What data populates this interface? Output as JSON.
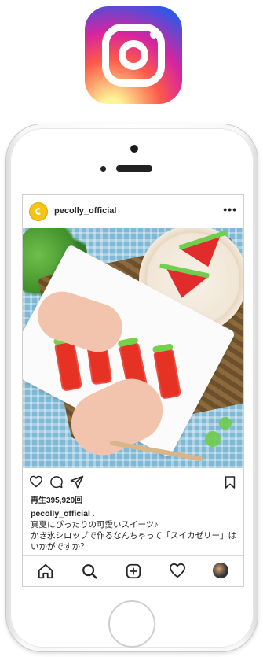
{
  "app": {
    "name": "Instagram"
  },
  "post": {
    "username": "pecolly_official",
    "more_icon": "•••",
    "views": "再生395,920回",
    "caption": {
      "username": "pecolly_official",
      "text": " .\n真夏にぴったりの可愛いスイーツ♪\nかき氷シロップで作るなんちゃって「スイカゼリー」はいかがですか？"
    }
  },
  "colors": {
    "accent_yellow": "#f6c317",
    "watermelon_red": "#e22b2b",
    "rind_green": "#6fcf4d",
    "instagram_gradient": [
      "#fdf497",
      "#fd5949",
      "#d6249f",
      "#285AEB"
    ]
  },
  "icons": {
    "logo": "instagram-logo",
    "like": "heart-icon",
    "comment": "comment-icon",
    "share": "paper-plane-icon",
    "save": "bookmark-icon",
    "nav_home": "home-icon",
    "nav_search": "search-icon",
    "nav_add": "add-post-icon",
    "nav_likes": "heart-icon",
    "nav_profile": "profile-avatar"
  }
}
